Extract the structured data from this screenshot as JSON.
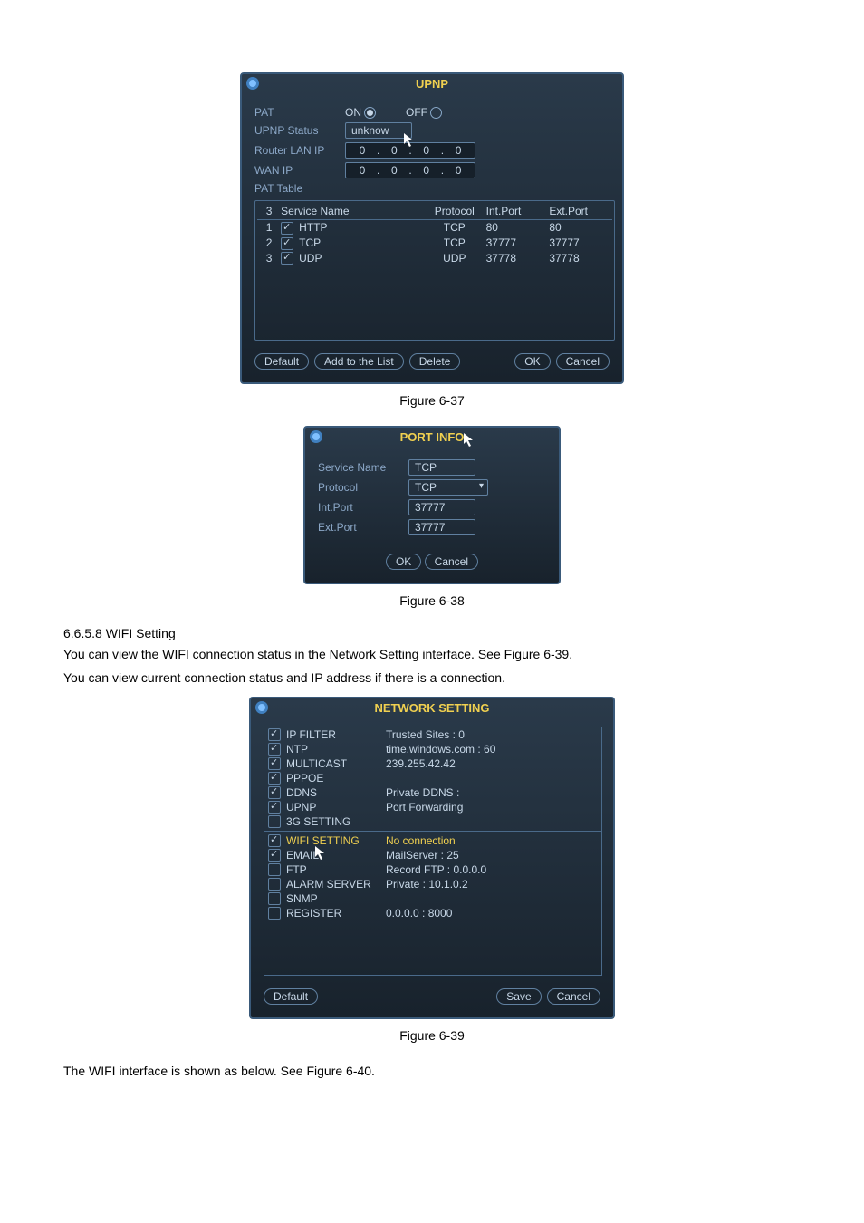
{
  "upnp": {
    "title": "UPNP",
    "pat_label": "PAT",
    "on_label": "ON",
    "off_label": "OFF",
    "pat_selected": "on",
    "upnp_status_label": "UPNP Status",
    "upnp_status_value": "unknow",
    "router_lan_label": "Router LAN IP",
    "router_lan_ip": [
      "0",
      "0",
      "0",
      "0"
    ],
    "wan_label": "WAN IP",
    "wan_ip": [
      "0",
      "0",
      "0",
      "0"
    ],
    "pat_table_label": "PAT Table",
    "headers": {
      "idx": "3",
      "name": "Service Name",
      "proto": "Protocol",
      "int": "Int.Port",
      "ext": "Ext.Port"
    },
    "rows": [
      {
        "idx": "1",
        "name": "HTTP",
        "proto": "TCP",
        "int": "80",
        "ext": "80"
      },
      {
        "idx": "2",
        "name": "TCP",
        "proto": "TCP",
        "int": "37777",
        "ext": "37777"
      },
      {
        "idx": "3",
        "name": "UDP",
        "proto": "UDP",
        "int": "37778",
        "ext": "37778"
      }
    ],
    "btn_default": "Default",
    "btn_add": "Add to the List",
    "btn_delete": "Delete",
    "btn_ok": "OK",
    "btn_cancel": "Cancel"
  },
  "fig637": "Figure 6-37",
  "portinfo": {
    "title": "PORT INFO",
    "service_name_label": "Service Name",
    "service_name_value": "TCP",
    "protocol_label": "Protocol",
    "protocol_value": "TCP",
    "int_label": "Int.Port",
    "int_value": "37777",
    "ext_label": "Ext.Port",
    "ext_value": "37777",
    "btn_ok": "OK",
    "btn_cancel": "Cancel"
  },
  "fig638": "Figure 6-38",
  "section_num": "6.6.5.8 WIFI Setting",
  "para1": "You can view the WIFI connection status in the Network Setting interface. See Figure 6-39.",
  "para2": "You can view current connection status and IP address if there is a connection.",
  "netset": {
    "title": "NETWORK SETTING",
    "rows": [
      {
        "checked": true,
        "name": "IP FILTER",
        "val": "Trusted Sites : 0"
      },
      {
        "checked": true,
        "name": "NTP",
        "val": "time.windows.com : 60"
      },
      {
        "checked": true,
        "name": "MULTICAST",
        "val": "239.255.42.42"
      },
      {
        "checked": true,
        "name": "PPPOE",
        "val": ""
      },
      {
        "checked": true,
        "name": "DDNS",
        "val": "Private DDNS :"
      },
      {
        "checked": true,
        "name": "UPNP",
        "val": "Port Forwarding"
      },
      {
        "checked": false,
        "name": "3G SETTING",
        "val": ""
      },
      {
        "checked": true,
        "name": "WIFI SETTING",
        "val": "No connection",
        "sel": true
      },
      {
        "checked": true,
        "name": "EMAIL",
        "val": "MailServer : 25"
      },
      {
        "checked": false,
        "name": "FTP",
        "val": "Record FTP : 0.0.0.0"
      },
      {
        "checked": false,
        "name": "ALARM SERVER",
        "val": "Private : 10.1.0.2"
      },
      {
        "checked": false,
        "name": "SNMP",
        "val": ""
      },
      {
        "checked": false,
        "name": "REGISTER",
        "val": "0.0.0.0 : 8000"
      }
    ],
    "btn_default": "Default",
    "btn_save": "Save",
    "btn_cancel": "Cancel"
  },
  "fig639": "Figure 6-39",
  "para3": "The WIFI interface is shown as below. See Figure 6-40."
}
